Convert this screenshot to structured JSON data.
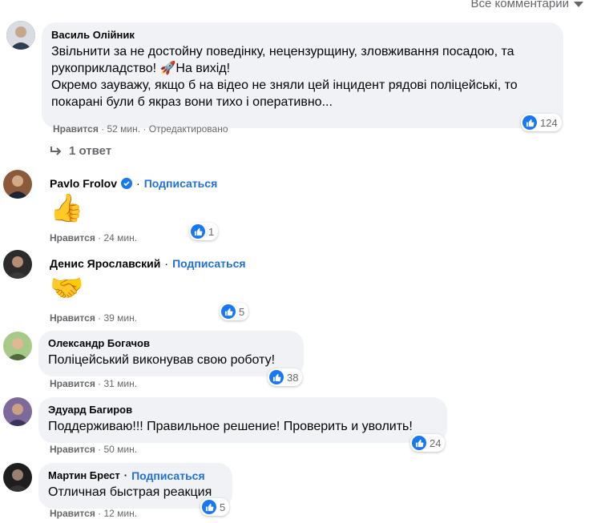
{
  "header": {
    "all_comments": "Все комментарии"
  },
  "labels": {
    "like": "Нравится",
    "subscribe": "Подписаться"
  },
  "comments": [
    {
      "author": "Василь Олійник",
      "lines": [
        "Звільнити за не достойну поведінку, нецензурщину, зловживання посадою, та",
        "рукоприкладство! 🚀На вихід!",
        "Окремо зауважу, якщо б на відео не зняли цей інцидент рядові поліцейські, то",
        "покарані були б якраз вони тихо і оперативно..."
      ],
      "time": "52 мин.",
      "edited": "Отредактировано",
      "reactions": "124"
    },
    {
      "author": "Pavlo Frolov",
      "verified": true,
      "emoji": "👍",
      "time": "24 мин.",
      "reactions": "1"
    },
    {
      "author": "Денис Ярославский",
      "emoji": "🤝",
      "time": "39 мин.",
      "reactions": "5"
    },
    {
      "author": "Олександр Богачов",
      "text": "Поліцейський виконував свою роботу!",
      "time": "31 мин.",
      "reactions": "38"
    },
    {
      "author": "Эдуард Багиров",
      "text": "Поддерживаю!!! Правильное решение! Проверить и уволить!",
      "time": "50 мин.",
      "reactions": "24"
    },
    {
      "author": "Мартин Брест",
      "text": "Отличная быстрая реакция",
      "time": "12 мин.",
      "reactions": "5"
    }
  ],
  "replies": {
    "label": "1 ответ"
  },
  "colors": {
    "link": "#216fdb",
    "bubble": "#f0f2f5",
    "like": "#1877f2",
    "meta": "#65676b"
  }
}
